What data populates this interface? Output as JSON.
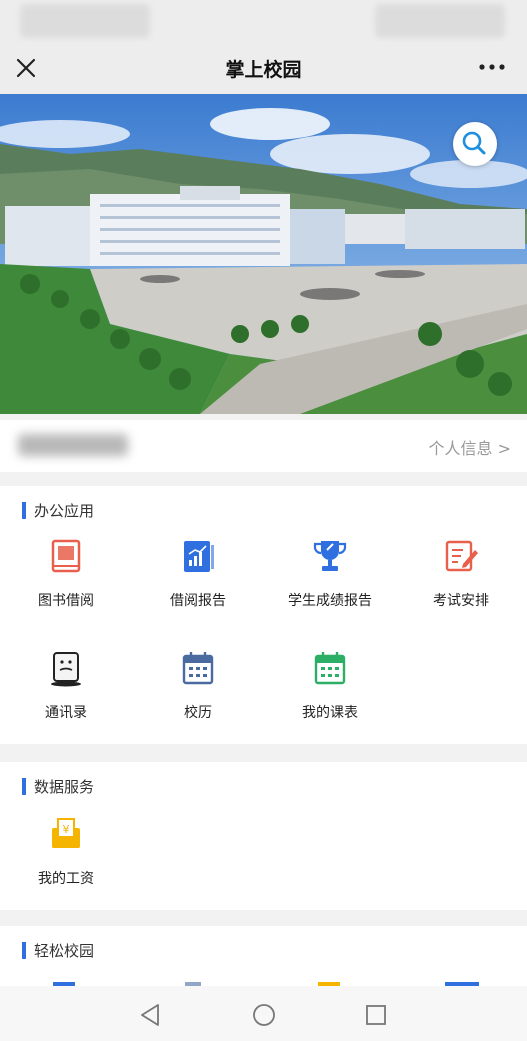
{
  "header": {
    "title": "掌上校园",
    "close_icon": "close-icon",
    "more_icon": "more-dots-icon"
  },
  "banner": {
    "search_icon": "search-icon"
  },
  "user": {
    "info_link": "个人信息 >"
  },
  "sections": {
    "office": {
      "title": "办公应用",
      "items": [
        {
          "label": "图书借阅",
          "icon": "book-icon"
        },
        {
          "label": "借阅报告",
          "icon": "report-chart-icon"
        },
        {
          "label": "学生成绩报告",
          "icon": "trophy-icon"
        },
        {
          "label": "考试安排",
          "icon": "exam-edit-icon"
        },
        {
          "label": "通讯录",
          "icon": "contacts-icon"
        },
        {
          "label": "校历",
          "icon": "calendar-icon"
        },
        {
          "label": "我的课表",
          "icon": "timetable-icon"
        }
      ]
    },
    "data": {
      "title": "数据服务",
      "items": [
        {
          "label": "我的工资",
          "icon": "salary-icon"
        }
      ]
    },
    "campus": {
      "title": "轻松校园"
    }
  },
  "colors": {
    "accent": "#2f6fe0",
    "icon_red": "#e8604c",
    "icon_blue": "#2f6fe0",
    "icon_slate": "#4a6aa0",
    "icon_green": "#2dae66",
    "icon_yellow": "#f4b400"
  }
}
